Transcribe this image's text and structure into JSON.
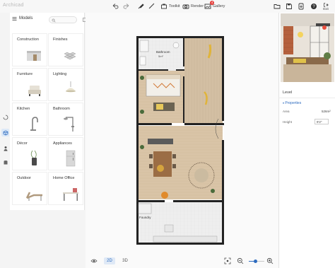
{
  "app": {
    "logo_text": "Archicad"
  },
  "toolbar": {
    "toolkit_label": "Toolkit",
    "render_label": "Render",
    "gallery_label": "Gallery",
    "gallery_badge": "4",
    "exit_label": "Exit"
  },
  "models_panel": {
    "title": "Models",
    "categories": [
      {
        "label": "Construction",
        "icon": "walls-icon"
      },
      {
        "label": "Finishes",
        "icon": "tiles-icon"
      },
      {
        "label": "Furniture",
        "icon": "armchair-icon"
      },
      {
        "label": "Lighting",
        "icon": "lamp-icon"
      },
      {
        "label": "Kitchen",
        "icon": "faucet-icon"
      },
      {
        "label": "Bathroom",
        "icon": "shower-icon"
      },
      {
        "label": "Décor",
        "icon": "vase-icon"
      },
      {
        "label": "Appliances",
        "icon": "fridge-icon"
      },
      {
        "label": "Outdoor",
        "icon": "lounger-icon"
      },
      {
        "label": "Home Office",
        "icon": "desk-icon"
      }
    ]
  },
  "floorplan": {
    "rooms": [
      {
        "name": "Bathroom",
        "area": "5m²"
      },
      {
        "name": "Foundry",
        "area": ""
      }
    ]
  },
  "view_toggle": {
    "mode_2d": "2D",
    "mode_3d": "3D",
    "active": "2D"
  },
  "zoom": {
    "level": 0.45
  },
  "properties_panel": {
    "level_title": "Level",
    "section_title": "Properties",
    "area_label": "Area",
    "area_value": "526m²",
    "height_label": "Height",
    "height_value": "9'2\""
  },
  "colors": {
    "accent": "#2d6bbf",
    "wall": "#222222",
    "floor": "#d7c2a6"
  }
}
